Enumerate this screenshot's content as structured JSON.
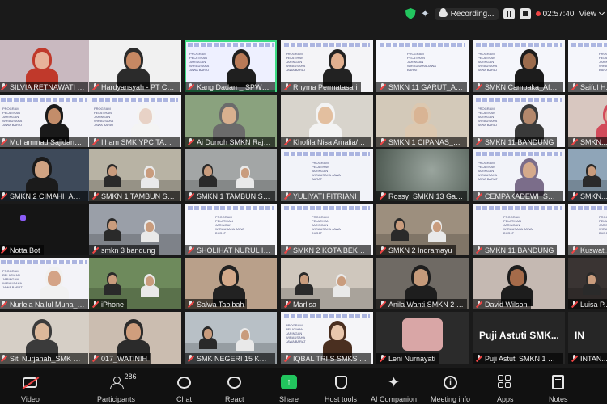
{
  "topbar": {
    "recording_label": "Recording...",
    "timer": "02:57:40",
    "view_label": "View"
  },
  "tiles": [
    {
      "name": "SILVIA RETNAWATI SMK...",
      "kind": "person",
      "bg": "#c9b9c0",
      "skin": "#e8b29a",
      "hair": "#c0392b"
    },
    {
      "name": "Hardyansyah - PT Chl...",
      "kind": "person",
      "bg": "#f1f1f1",
      "skin": "#c68863",
      "hair": "#2b2b2b"
    },
    {
      "name": "Kang Dadan _ SPW@sms...",
      "kind": "slide-person",
      "bg": "#eef0ff",
      "skin": "#b97a57",
      "hair": "#1f1f1f",
      "active": true
    },
    {
      "name": "Rhyma Permatasari",
      "kind": "slide-person",
      "bg": "#f4f4f7",
      "skin": "#e2b08f",
      "hair": "#222"
    },
    {
      "name": "SMKN 11 GARUT_AZW...",
      "kind": "slide",
      "bg": "#f5f6fb"
    },
    {
      "name": "SMKN Campaka_Afwal...",
      "kind": "slide-person",
      "bg": "#f5f6fb",
      "skin": "#9b6b4c",
      "hair": "#1c1c1c"
    },
    {
      "name": "Saiful H...",
      "kind": "slide",
      "bg": "#f5f6fb"
    },
    {
      "name": "Muhammad Sajidan_S...",
      "kind": "slide-person",
      "bg": "#f3f3f8",
      "skin": "#c38d6a",
      "hair": "#1a1a1a"
    },
    {
      "name": "Ilham SMK YPC TASIK...",
      "kind": "slide-person",
      "bg": "#f3f3f8",
      "skin": "#e8d2c6",
      "hair": "#f4f4f4"
    },
    {
      "name": "Ai Durroh SMKN Rajap...",
      "kind": "person",
      "bg": "#8aa27e",
      "skin": "#d9b08f",
      "hair": "#6b6b6b"
    },
    {
      "name": "Khofila Nisa Amalia/S...",
      "kind": "person",
      "bg": "#d8d4cc",
      "skin": "#e3bf9f",
      "hair": "#f3f3f3"
    },
    {
      "name": "SMKN 1 CIPANAS_Fitri...",
      "kind": "person",
      "bg": "#d3c9b9",
      "skin": "#d9b494",
      "hair": "#dcc8b0"
    },
    {
      "name": "SMKN 11 BANDUNG",
      "kind": "slide-person",
      "bg": "#f3f3f8",
      "skin": "#b4886c",
      "hair": "#3a3a3a"
    },
    {
      "name": "SMKN...",
      "kind": "person",
      "bg": "#d8c7c0",
      "skin": "#e0a796",
      "hair": "#d24a5a"
    },
    {
      "name": "SMKN 2 CIMAHI_ADI F...",
      "kind": "person",
      "bg": "#3e4a5a",
      "skin": "#d0a383",
      "hair": "#1b1b1b"
    },
    {
      "name": "SMKN 1 TAMBUN SEL...",
      "kind": "room",
      "bg": "#b8b3a4"
    },
    {
      "name": "SMKN 1 TAMBUN SEL...",
      "kind": "room",
      "bg": "#a3a6a6"
    },
    {
      "name": "YULIYATI FITRIANI",
      "kind": "slide",
      "bg": "#f2f3f9"
    },
    {
      "name": "Rossy_SMKN 13 Garut",
      "kind": "blur",
      "bg": "#5b6a62"
    },
    {
      "name": "CEMPAKADEWI_SMKN...",
      "kind": "slide-person",
      "bg": "#f2f3f9",
      "skin": "#d5aa8b",
      "hair": "#7b6d8a"
    },
    {
      "name": "SMKN...",
      "kind": "room",
      "bg": "#8fa5b8"
    },
    {
      "name": "Notta Bot",
      "kind": "bot",
      "bg": "#151515"
    },
    {
      "name": "smkn 3 bandung",
      "kind": "room",
      "bg": "#9a9fa8"
    },
    {
      "name": "SHOLIHAT NURUL INS...",
      "kind": "slide",
      "bg": "#f7f7fb"
    },
    {
      "name": "SMKN 2 KOTA BEKASI",
      "kind": "slide",
      "bg": "#f7f7fb"
    },
    {
      "name": "SMKN 2 Indramayu",
      "kind": "room",
      "bg": "#9d8f7e"
    },
    {
      "name": "SMKN 11 BANDUNG",
      "kind": "slide",
      "bg": "#f3f3f8"
    },
    {
      "name": "Kuswat...",
      "kind": "slide",
      "bg": "#f3f3f8"
    },
    {
      "name": "Nurlela Nailul Muna_S...",
      "kind": "slide-person",
      "bg": "#f3f3f8",
      "skin": "#d4a386",
      "hair": "#f1f1f1"
    },
    {
      "name": "iPhone",
      "kind": "room",
      "bg": "#6e8a5c"
    },
    {
      "name": "Salwa Tabibah",
      "kind": "person",
      "bg": "#b9a08a",
      "skin": "#d3a98a",
      "hair": "#222"
    },
    {
      "name": "Marlisa",
      "kind": "room",
      "bg": "#cfc7bd"
    },
    {
      "name": "Anila Wanti SMKN 2 S...",
      "kind": "person",
      "bg": "#6f6a64",
      "skin": "#c59a7a",
      "hair": "#1e1e1e"
    },
    {
      "name": "David Wilson",
      "kind": "person",
      "bg": "#c5b9b2",
      "skin": "#a56b4a",
      "hair": "#1d1d1d"
    },
    {
      "name": "Luisa P...",
      "kind": "room",
      "bg": "#3a3433"
    },
    {
      "name": "Siti Nurjanah_SMK Me...",
      "kind": "person",
      "bg": "#d6cfc6",
      "skin": "#dcb89a",
      "hair": "#3b3b3b"
    },
    {
      "name": "017_WATINIH",
      "kind": "person",
      "bg": "#cbbdb0",
      "skin": "#cf9e7d",
      "hair": "#2b2b2b"
    },
    {
      "name": "SMK NEGERI 15 KOTA...",
      "kind": "room",
      "bg": "#b8c0c6"
    },
    {
      "name": "IQBAL TRI S SMKS YP...",
      "kind": "slide-person",
      "bg": "#f5f5f8",
      "skin": "#e8c7ad",
      "hair": "#4a2f20"
    },
    {
      "name": "Leni Nurnayati",
      "kind": "avatar",
      "bg": "#2b2b2b"
    },
    {
      "name": "Puji Astuti SMKN 1 CIK...",
      "kind": "text",
      "bg": "#262626",
      "big": "Puji Astuti SMK..."
    },
    {
      "name": "INTAN...",
      "kind": "text",
      "bg": "#262626",
      "big": "IN"
    }
  ],
  "toolbar": {
    "video": "Video",
    "participants": "Participants",
    "participants_count": "286",
    "chat": "Chat",
    "react": "React",
    "share": "Share",
    "host_tools": "Host tools",
    "ai_companion": "AI Companion",
    "meeting_info": "Meeting info",
    "apps": "Apps",
    "notes": "Notes"
  },
  "slide_text": "PROGRAM PELATIHAN JARINGAN WIRAUSAHA JAWA BARAT"
}
